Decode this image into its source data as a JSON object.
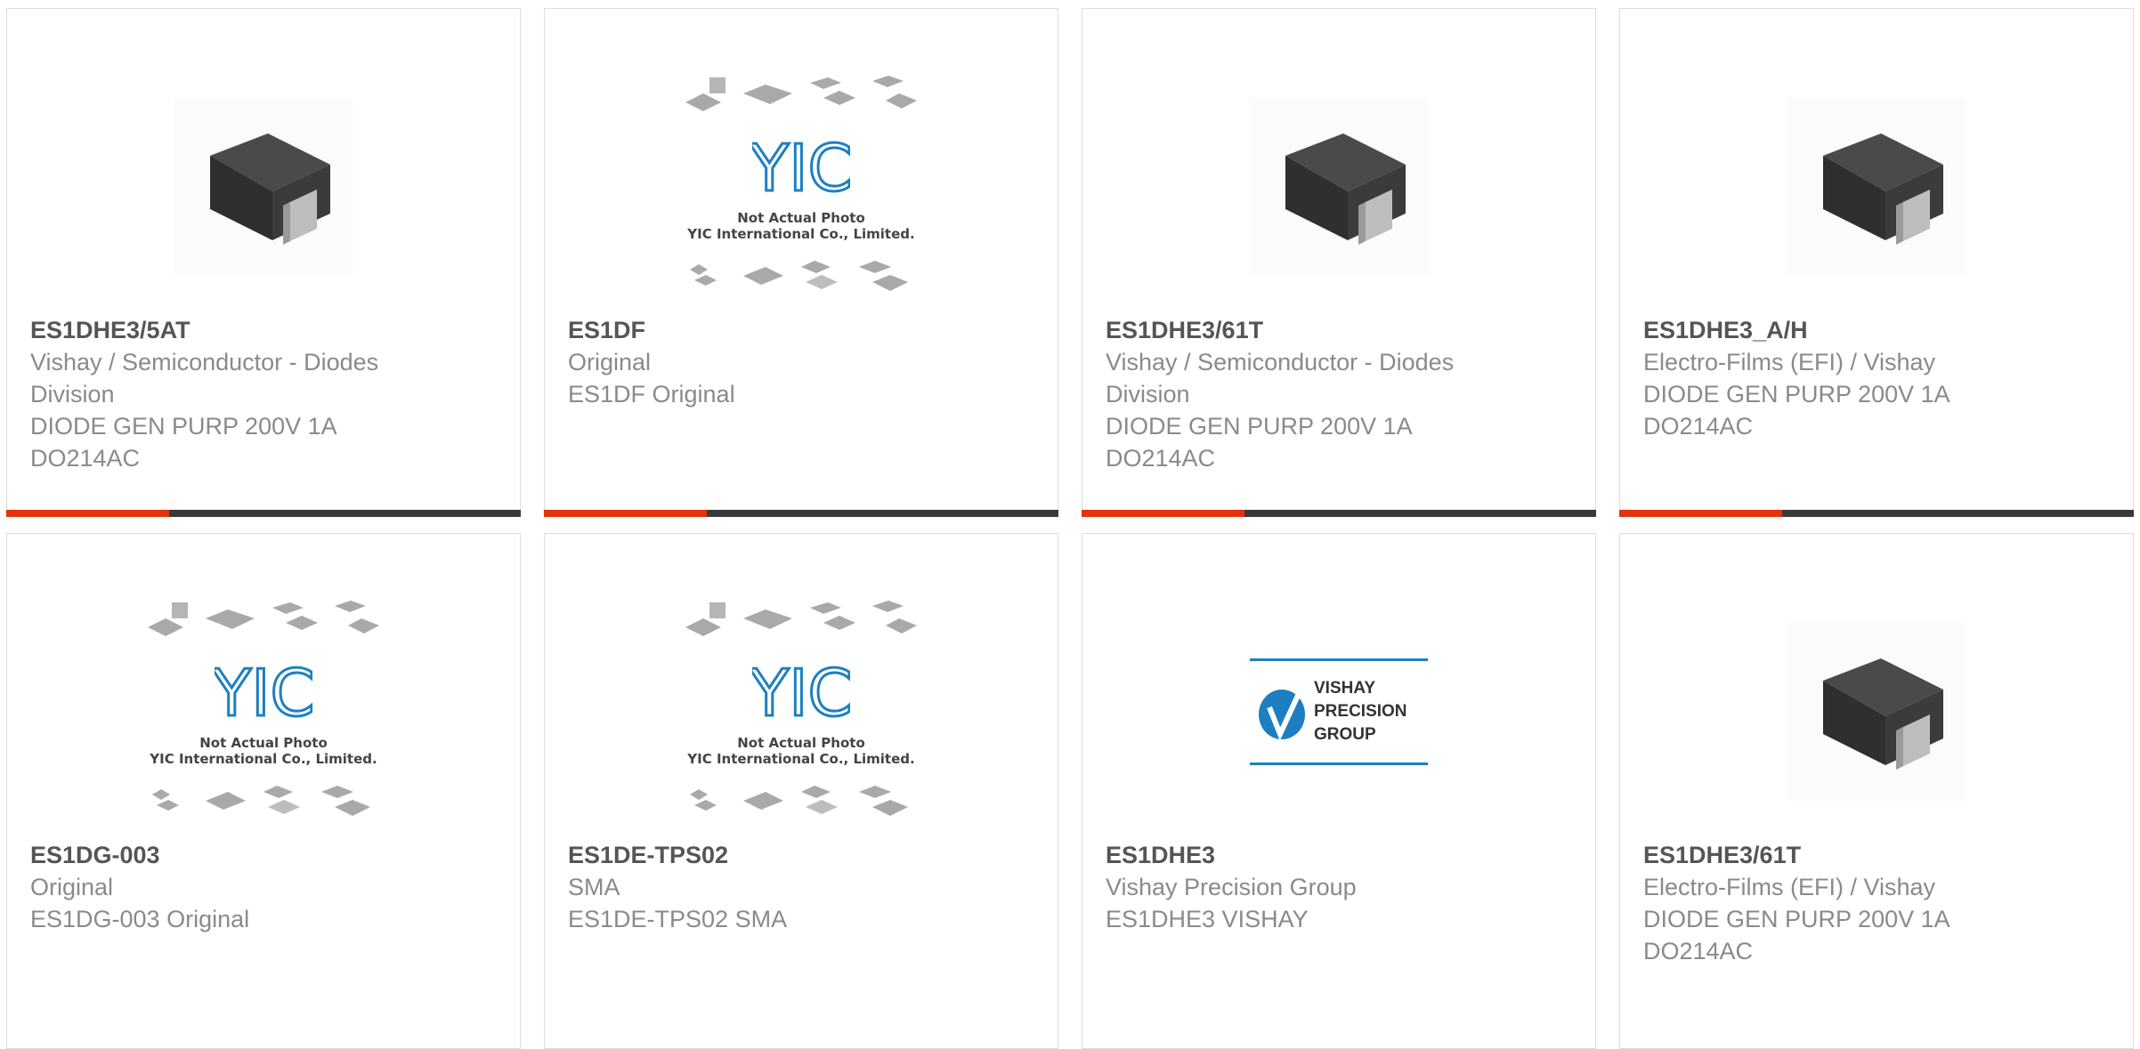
{
  "products": [
    {
      "part": "ES1DHE3/5AT",
      "lines": [
        "Vishay / Semiconductor - Diodes",
        "Division",
        "DIODE GEN PURP 200V 1A",
        "DO214AC"
      ],
      "image": "diode-package",
      "bar": true
    },
    {
      "part": "ES1DF",
      "lines": [
        "Original",
        "ES1DF Original"
      ],
      "image": "yic-placeholder",
      "bar": true
    },
    {
      "part": "ES1DHE3/61T",
      "lines": [
        "Vishay / Semiconductor - Diodes",
        "Division",
        "DIODE GEN PURP 200V 1A",
        "DO214AC"
      ],
      "image": "diode-package",
      "bar": true
    },
    {
      "part": "ES1DHE3_A/H",
      "lines": [
        "Electro-Films (EFI) / Vishay",
        "DIODE GEN PURP 200V 1A",
        "DO214AC"
      ],
      "image": "diode-package",
      "bar": true
    },
    {
      "part": "ES1DG-003",
      "lines": [
        "Original",
        "ES1DG-003 Original"
      ],
      "image": "yic-placeholder",
      "bar": false
    },
    {
      "part": "ES1DE-TPS02",
      "lines": [
        "SMA",
        "ES1DE-TPS02 SMA"
      ],
      "image": "yic-placeholder",
      "bar": false
    },
    {
      "part": "ES1DHE3",
      "lines": [
        "Vishay Precision Group",
        "ES1DHE3 VISHAY"
      ],
      "image": "vishay-precision-logo",
      "bar": false
    },
    {
      "part": "ES1DHE3/61T",
      "lines": [
        "Electro-Films (EFI) / Vishay",
        "DIODE GEN PURP 200V 1A",
        "DO214AC"
      ],
      "image": "diode-package",
      "bar": false
    }
  ],
  "placeholder": {
    "caption_line1": "Not Actual Photo",
    "caption_line2": "YIC International Co., Limited.",
    "logo_text": "YIC"
  },
  "vishay_logo": {
    "line1": "VISHAY",
    "line2": "PRECISION",
    "line3": "GROUP"
  },
  "colors": {
    "accent": "#e2330e",
    "bar": "#3a3a3a",
    "border": "#dcdcdc",
    "text_muted": "#8a8a8a",
    "text_part": "#555555",
    "logo_blue": "#1d7fc1"
  }
}
